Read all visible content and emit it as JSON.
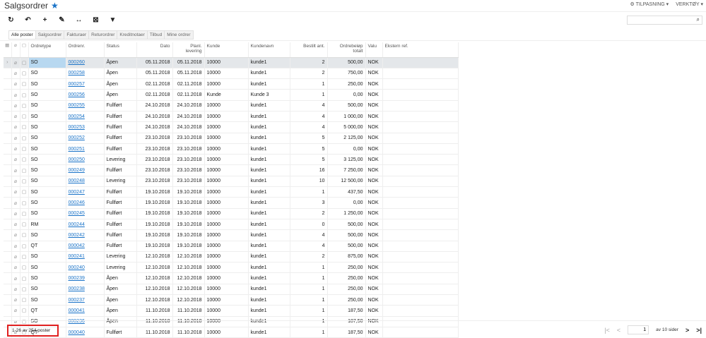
{
  "header": {
    "title": "Salgsordrer",
    "customize": "TILPASNING",
    "tools": "VERKTØY"
  },
  "tabs": [
    "Alle poster",
    "Salgsordrer",
    "Fakturaer",
    "Returordrer",
    "Kreditnotaer",
    "Tilbud",
    "Mine ordrer"
  ],
  "columns": [
    "Ordretype",
    "Ordrenr.",
    "Status",
    "Dato",
    "Planl. levering",
    "Kunde",
    "Kundenavn",
    "Bestilt ant.",
    "Ordrebeløp totalt",
    "Valu",
    "Ekstern ref."
  ],
  "rows": [
    [
      "SO",
      "000260",
      "Åpen",
      "05.11.2018",
      "05.11.2018",
      "10000",
      "kunde1",
      "2",
      "500,00",
      "NOK"
    ],
    [
      "SO",
      "000258",
      "Åpen",
      "05.11.2018",
      "05.11.2018",
      "10000",
      "kunde1",
      "2",
      "750,00",
      "NOK"
    ],
    [
      "SO",
      "000257",
      "Åpen",
      "02.11.2018",
      "02.11.2018",
      "10000",
      "kunde1",
      "1",
      "250,00",
      "NOK"
    ],
    [
      "SO",
      "000256",
      "Åpen",
      "02.11.2018",
      "02.11.2018",
      "Kunde",
      "Kunde 3",
      "1",
      "0,00",
      "NOK"
    ],
    [
      "SO",
      "000255",
      "Fullført",
      "24.10.2018",
      "24.10.2018",
      "10000",
      "kunde1",
      "4",
      "500,00",
      "NOK"
    ],
    [
      "SO",
      "000254",
      "Fullført",
      "24.10.2018",
      "24.10.2018",
      "10000",
      "kunde1",
      "4",
      "1 000,00",
      "NOK"
    ],
    [
      "SO",
      "000253",
      "Fullført",
      "24.10.2018",
      "24.10.2018",
      "10000",
      "kunde1",
      "4",
      "5 000,00",
      "NOK"
    ],
    [
      "SO",
      "000252",
      "Fullført",
      "23.10.2018",
      "23.10.2018",
      "10000",
      "kunde1",
      "5",
      "2 125,00",
      "NOK"
    ],
    [
      "SO",
      "000251",
      "Fullført",
      "23.10.2018",
      "23.10.2018",
      "10000",
      "kunde1",
      "5",
      "0,00",
      "NOK"
    ],
    [
      "SO",
      "000250",
      "Levering",
      "23.10.2018",
      "23.10.2018",
      "10000",
      "kunde1",
      "5",
      "3 125,00",
      "NOK"
    ],
    [
      "SO",
      "000249",
      "Fullført",
      "23.10.2018",
      "23.10.2018",
      "10000",
      "kunde1",
      "16",
      "7 250,00",
      "NOK"
    ],
    [
      "SO",
      "000248",
      "Levering",
      "23.10.2018",
      "23.10.2018",
      "10000",
      "kunde1",
      "10",
      "12 500,00",
      "NOK"
    ],
    [
      "SO",
      "000247",
      "Fullført",
      "19.10.2018",
      "19.10.2018",
      "10000",
      "kunde1",
      "1",
      "437,50",
      "NOK"
    ],
    [
      "SO",
      "000246",
      "Fullført",
      "19.10.2018",
      "19.10.2018",
      "10000",
      "kunde1",
      "3",
      "0,00",
      "NOK"
    ],
    [
      "SO",
      "000245",
      "Fullført",
      "19.10.2018",
      "19.10.2018",
      "10000",
      "kunde1",
      "2",
      "1 250,00",
      "NOK"
    ],
    [
      "RM",
      "000244",
      "Fullført",
      "19.10.2018",
      "19.10.2018",
      "10000",
      "kunde1",
      "0",
      "500,00",
      "NOK"
    ],
    [
      "SO",
      "000242",
      "Fullført",
      "19.10.2018",
      "19.10.2018",
      "10000",
      "kunde1",
      "4",
      "500,00",
      "NOK"
    ],
    [
      "QT",
      "000042",
      "Fullført",
      "19.10.2018",
      "19.10.2018",
      "10000",
      "kunde1",
      "4",
      "500,00",
      "NOK"
    ],
    [
      "SO",
      "000241",
      "Levering",
      "12.10.2018",
      "12.10.2018",
      "10000",
      "kunde1",
      "2",
      "875,00",
      "NOK"
    ],
    [
      "SO",
      "000240",
      "Levering",
      "12.10.2018",
      "12.10.2018",
      "10000",
      "kunde1",
      "1",
      "250,00",
      "NOK"
    ],
    [
      "SO",
      "000239",
      "Åpen",
      "12.10.2018",
      "12.10.2018",
      "10000",
      "kunde1",
      "1",
      "250,00",
      "NOK"
    ],
    [
      "SO",
      "000238",
      "Åpen",
      "12.10.2018",
      "12.10.2018",
      "10000",
      "kunde1",
      "1",
      "250,00",
      "NOK"
    ],
    [
      "SO",
      "000237",
      "Åpen",
      "12.10.2018",
      "12.10.2018",
      "10000",
      "kunde1",
      "1",
      "250,00",
      "NOK"
    ],
    [
      "QT",
      "000041",
      "Åpen",
      "11.10.2018",
      "11.10.2018",
      "10000",
      "kunde1",
      "1",
      "187,50",
      "NOK"
    ],
    [
      "SO",
      "000236",
      "Åpen",
      "11.10.2018",
      "11.10.2018",
      "10000",
      "kunde1",
      "1",
      "187,50",
      "NOK"
    ],
    [
      "QT",
      "000040",
      "Fullført",
      "11.10.2018",
      "11.10.2018",
      "10000",
      "kunde1",
      "1",
      "187,50",
      "NOK"
    ]
  ],
  "footer": {
    "count": "1-26 av 254 poster",
    "page": "1",
    "pages_label": "av 10 sider"
  }
}
